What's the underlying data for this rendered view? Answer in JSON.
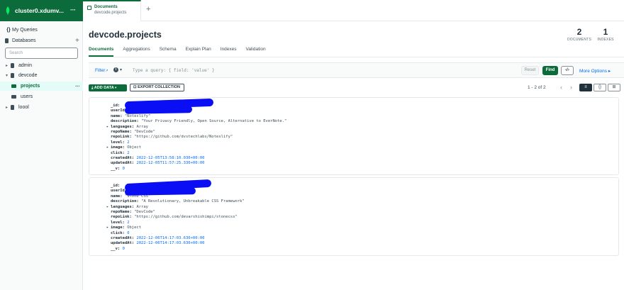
{
  "connection": {
    "title": "cluster0.xdumv...",
    "more": "···"
  },
  "tab": {
    "title": "Documents",
    "subtitle": "devcode.projects",
    "add": "+"
  },
  "sidebar": {
    "my_queries": "My Queries",
    "databases": "Databases",
    "add": "+",
    "search_placeholder": "Search",
    "items": [
      {
        "label": "admin"
      },
      {
        "label": "devcode"
      },
      {
        "label": "projects"
      },
      {
        "label": "users"
      },
      {
        "label": "loool"
      }
    ],
    "item_more": "···"
  },
  "header": {
    "namespace": "devcode.projects",
    "documents_count": "2",
    "documents_label": "DOCUMENTS",
    "indexes_count": "1",
    "indexes_label": "INDEXES"
  },
  "subtabs": [
    "Documents",
    "Aggregations",
    "Schema",
    "Explain Plan",
    "Indexes",
    "Validation"
  ],
  "query": {
    "filter_label": "Filter",
    "info": "i",
    "caret": "▾",
    "placeholder": "Type a query: { field: 'value' }",
    "reset": "Reset",
    "find": "Find",
    "code": "‹/›",
    "more_options": "More Options ▸"
  },
  "toolbar": {
    "add_data": "ADD DATA ▾",
    "export": "EXPORT COLLECTION",
    "pager": "1 - 2 of 2",
    "prev": "‹",
    "next": "›",
    "view_list": "≡",
    "view_json": "{}",
    "view_table": "⊞"
  },
  "documents": [
    {
      "fields": [
        {
          "key": "_id:",
          "value": "",
          "kind": "str"
        },
        {
          "key": "userId:",
          "value": "",
          "kind": "str"
        },
        {
          "key": "name:",
          "value": "\"Noteslify\"",
          "kind": "str"
        },
        {
          "key": "description:",
          "value": "\"Your Privacy Friendly, Open Source, Alternative to EverNote.\"",
          "kind": "str"
        },
        {
          "key": "languages:",
          "value": "Array",
          "kind": "type",
          "expand": true
        },
        {
          "key": "repoName:",
          "value": "\"DevCode\"",
          "kind": "str"
        },
        {
          "key": "repoLink:",
          "value": "\"https://github.com/dvstechlabs/Noteslify\"",
          "kind": "str"
        },
        {
          "key": "level:",
          "value": "2",
          "kind": "num"
        },
        {
          "key": "image:",
          "value": "Object",
          "kind": "type",
          "expand": true
        },
        {
          "key": "click:",
          "value": "2",
          "kind": "num"
        },
        {
          "key": "createdAt:",
          "value": "2022-12-05T13:58:10.030+00:00",
          "kind": "num"
        },
        {
          "key": "updatedAt:",
          "value": "2022-12-05T11:57:25.330+00:00",
          "kind": "num"
        },
        {
          "key": "__v:",
          "value": "0",
          "kind": "num"
        }
      ]
    },
    {
      "fields": [
        {
          "key": "_id:",
          "value": "",
          "kind": "str"
        },
        {
          "key": "userId:",
          "value": "",
          "kind": "str"
        },
        {
          "key": "name:",
          "value": "\"Stone CSS\"",
          "kind": "str"
        },
        {
          "key": "description:",
          "value": "\"A Revolutionary, Unbreakable CSS Framework\"",
          "kind": "str"
        },
        {
          "key": "languages:",
          "value": "Array",
          "kind": "type",
          "expand": true
        },
        {
          "key": "repoName:",
          "value": "\"DevCode\"",
          "kind": "str"
        },
        {
          "key": "repoLink:",
          "value": "\"https://github.com/devarshishimpi/stonecss\"",
          "kind": "str"
        },
        {
          "key": "level:",
          "value": "2",
          "kind": "num"
        },
        {
          "key": "image:",
          "value": "Object",
          "kind": "type",
          "expand": true
        },
        {
          "key": "click:",
          "value": "0",
          "kind": "num"
        },
        {
          "key": "createdAt:",
          "value": "2022-12-06T14:17:03.630+00:00",
          "kind": "num"
        },
        {
          "key": "updatedAt:",
          "value": "2022-12-06T14:17:03.630+00:00",
          "kind": "num"
        },
        {
          "key": "__v:",
          "value": "0",
          "kind": "num"
        }
      ]
    }
  ],
  "colors": {
    "brand": "#0b6b3a",
    "link": "#016bf8",
    "redaction": "#0a0ef5"
  }
}
